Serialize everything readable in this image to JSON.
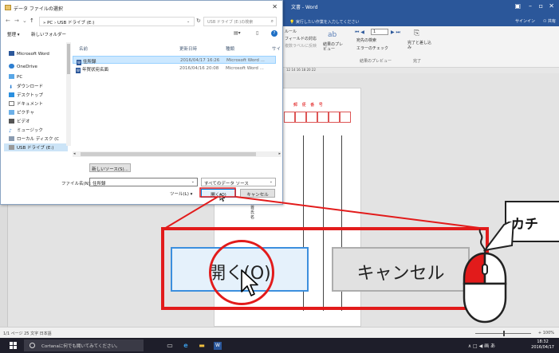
{
  "word": {
    "title": "文書 - Word",
    "tell_me": "実行したい作業を入力してください",
    "sign_in": "サインイン",
    "share": "共有",
    "ribbon": {
      "rule": "ルール",
      "field": "フィールドの対応",
      "duplicate": "複数ラベルに反映",
      "preview": "結果のプレビュー",
      "record_no": "1",
      "find_recipient": "宛先の検索",
      "error_check": "エラーのチェック",
      "finish": "完了と差し込み",
      "group_preview": "結果のプレビュー",
      "group_finish": "完了"
    },
    "ruler": "12  14  16  18  20  22",
    "red_label": "郵 便 番 号",
    "vertical_text": "首氏名",
    "status_left": "1/1 ページ   25 文字   日本語",
    "zoom": "+ 100%"
  },
  "dialog": {
    "title": "データ ファイルの選択",
    "address": "» PC › USB ドライブ (E:)",
    "search_placeholder": "USB ドライブ (E:)の検索",
    "organize": "整理 ▾",
    "new_folder": "新しいフォルダー",
    "nav_items": [
      "Microsoft Word",
      "OneDrive",
      "PC",
      "ダウンロード",
      "デスクトップ",
      "ドキュメント",
      "ピクチャ",
      "ビデオ",
      "ミュージック",
      "ローカル ディスク (C",
      "USB ドライブ (E:)"
    ],
    "columns": [
      "名前",
      "更新日時",
      "種類",
      "サイ"
    ],
    "files": [
      {
        "name": "住所録",
        "date": "2016/04/17 16:26",
        "type": "Microsoft Word ..."
      },
      {
        "name": "年賀状宛名面",
        "date": "2016/04/16 20:08",
        "type": "Microsoft Word ..."
      }
    ],
    "new_source": "新しいソース(S)...",
    "filename_label": "ファイル名(N):",
    "filename_value": "住所録",
    "filetype": "すべてのデータ ソース",
    "tools": "ツール(L) ▾",
    "open": "開く(O)",
    "cancel": "キャンセル"
  },
  "callout": {
    "open": "開く(O)",
    "cancel": "キャンセル",
    "bubble": "カチ"
  },
  "taskbar": {
    "cortana": "Cortanaに何でも聞いてみてください。",
    "tray": "∧ □ ◀ 画 あ",
    "time": "18:32",
    "date": "2016/04/17"
  },
  "colors": {
    "word_blue": "#2b579a",
    "callout_red": "#e21b1b",
    "open_blue": "#3c8fde"
  }
}
